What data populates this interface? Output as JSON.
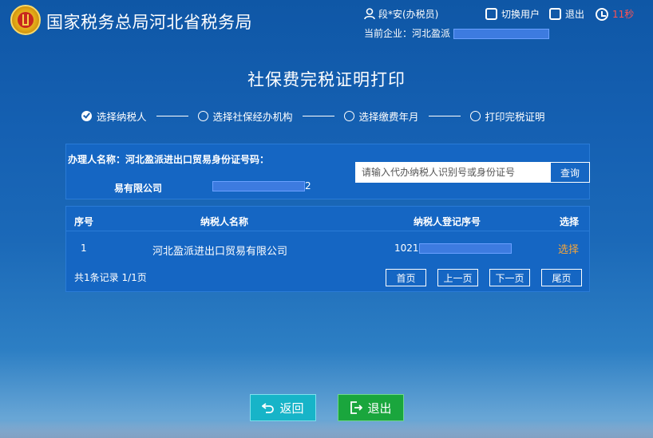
{
  "header": {
    "title": "国家税务总局河北省税务局",
    "user_label": "段*安(办税员)",
    "switch_user": "切换用户",
    "logout": "退出",
    "timer": "11秒",
    "enterprise_label": "当前企业：河北盈派"
  },
  "page_title": "社保费完税证明打印",
  "steps": [
    {
      "label": "选择纳税人",
      "checked": true
    },
    {
      "label": "选择社保经办机构",
      "checked": false
    },
    {
      "label": "选择缴费年月",
      "checked": false
    },
    {
      "label": "打印完税证明",
      "checked": false
    }
  ],
  "info": {
    "handler_label": "办理人名称：河北盈派进出口贸易身份证号码：",
    "name_line2": "易有限公司",
    "id_suffix": "2",
    "search_placeholder": "请输入代办纳税人识别号或身份证号",
    "search_button": "查询"
  },
  "table": {
    "headers": [
      "序号",
      "纳税人名称",
      "纳税人登记序号",
      "选择"
    ],
    "rows": [
      {
        "index": "1",
        "name": "河北盈派进出口贸易有限公司",
        "reg_prefix": "1021",
        "action": "选择"
      }
    ],
    "pager_info": "共1条记录  1/1页",
    "pager_buttons": [
      "首页",
      "上一页",
      "下一页",
      "尾页"
    ]
  },
  "footer": {
    "back": "返回",
    "exit": "退出"
  },
  "colors": {
    "background": "#1560b2",
    "panel": "#1566c3",
    "select_link": "#f4a53b",
    "timer": "#ff5252",
    "back_button": "#17b4c8",
    "exit_button": "#1aa63d"
  }
}
